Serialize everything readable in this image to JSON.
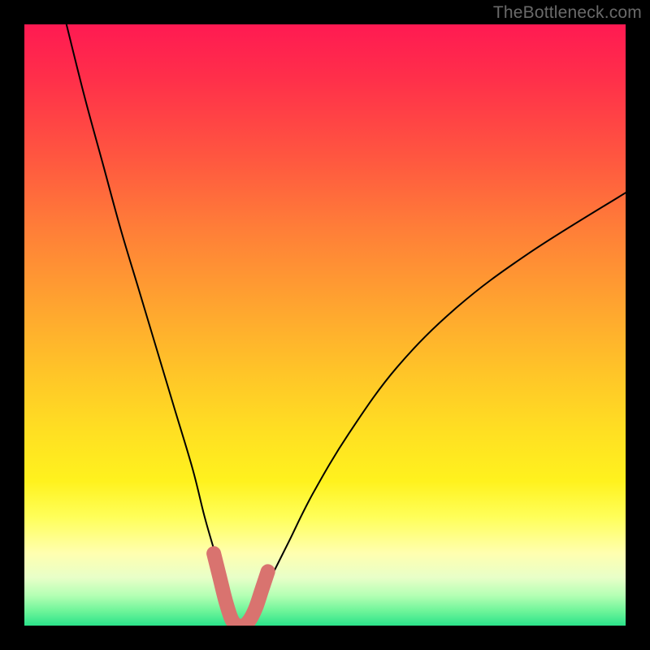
{
  "watermark": {
    "text": "TheBottleneck.com"
  },
  "chart_data": {
    "type": "line",
    "title": "",
    "xlabel": "",
    "ylabel": "",
    "xlim": [
      0,
      100
    ],
    "ylim": [
      0,
      100
    ],
    "grid": false,
    "legend": false,
    "background_gradient": {
      "orientation": "vertical",
      "stops": [
        {
          "pos": 0.0,
          "color": "#ff1a52"
        },
        {
          "pos": 0.5,
          "color": "#ffc528"
        },
        {
          "pos": 0.8,
          "color": "#ffff5a"
        },
        {
          "pos": 0.95,
          "color": "#b4ffb4"
        },
        {
          "pos": 1.0,
          "color": "#2be38a"
        }
      ]
    },
    "series": [
      {
        "name": "bottleneck-curve",
        "color": "#000000",
        "stroke_width": 2,
        "x": [
          7,
          10,
          13,
          16,
          19,
          22,
          25,
          28,
          30,
          32,
          33.5,
          35,
          36,
          37,
          38,
          40,
          42,
          44,
          48,
          54,
          62,
          72,
          84,
          100
        ],
        "y": [
          100,
          88,
          77,
          66,
          56,
          46,
          36,
          26,
          18,
          11,
          5,
          0,
          0,
          0,
          2,
          6,
          10,
          14,
          22,
          32,
          43,
          53,
          62,
          72
        ]
      },
      {
        "name": "highlight-band",
        "color": "#d9736f",
        "stroke_width": 12,
        "linecap": "round",
        "x": [
          31.5,
          32.5,
          33.5,
          34.5,
          35.5,
          36.5,
          37.5,
          38.5,
          39.5,
          40.5
        ],
        "y": [
          12,
          8,
          4,
          1,
          0,
          0,
          1,
          3,
          6,
          9
        ]
      }
    ]
  }
}
